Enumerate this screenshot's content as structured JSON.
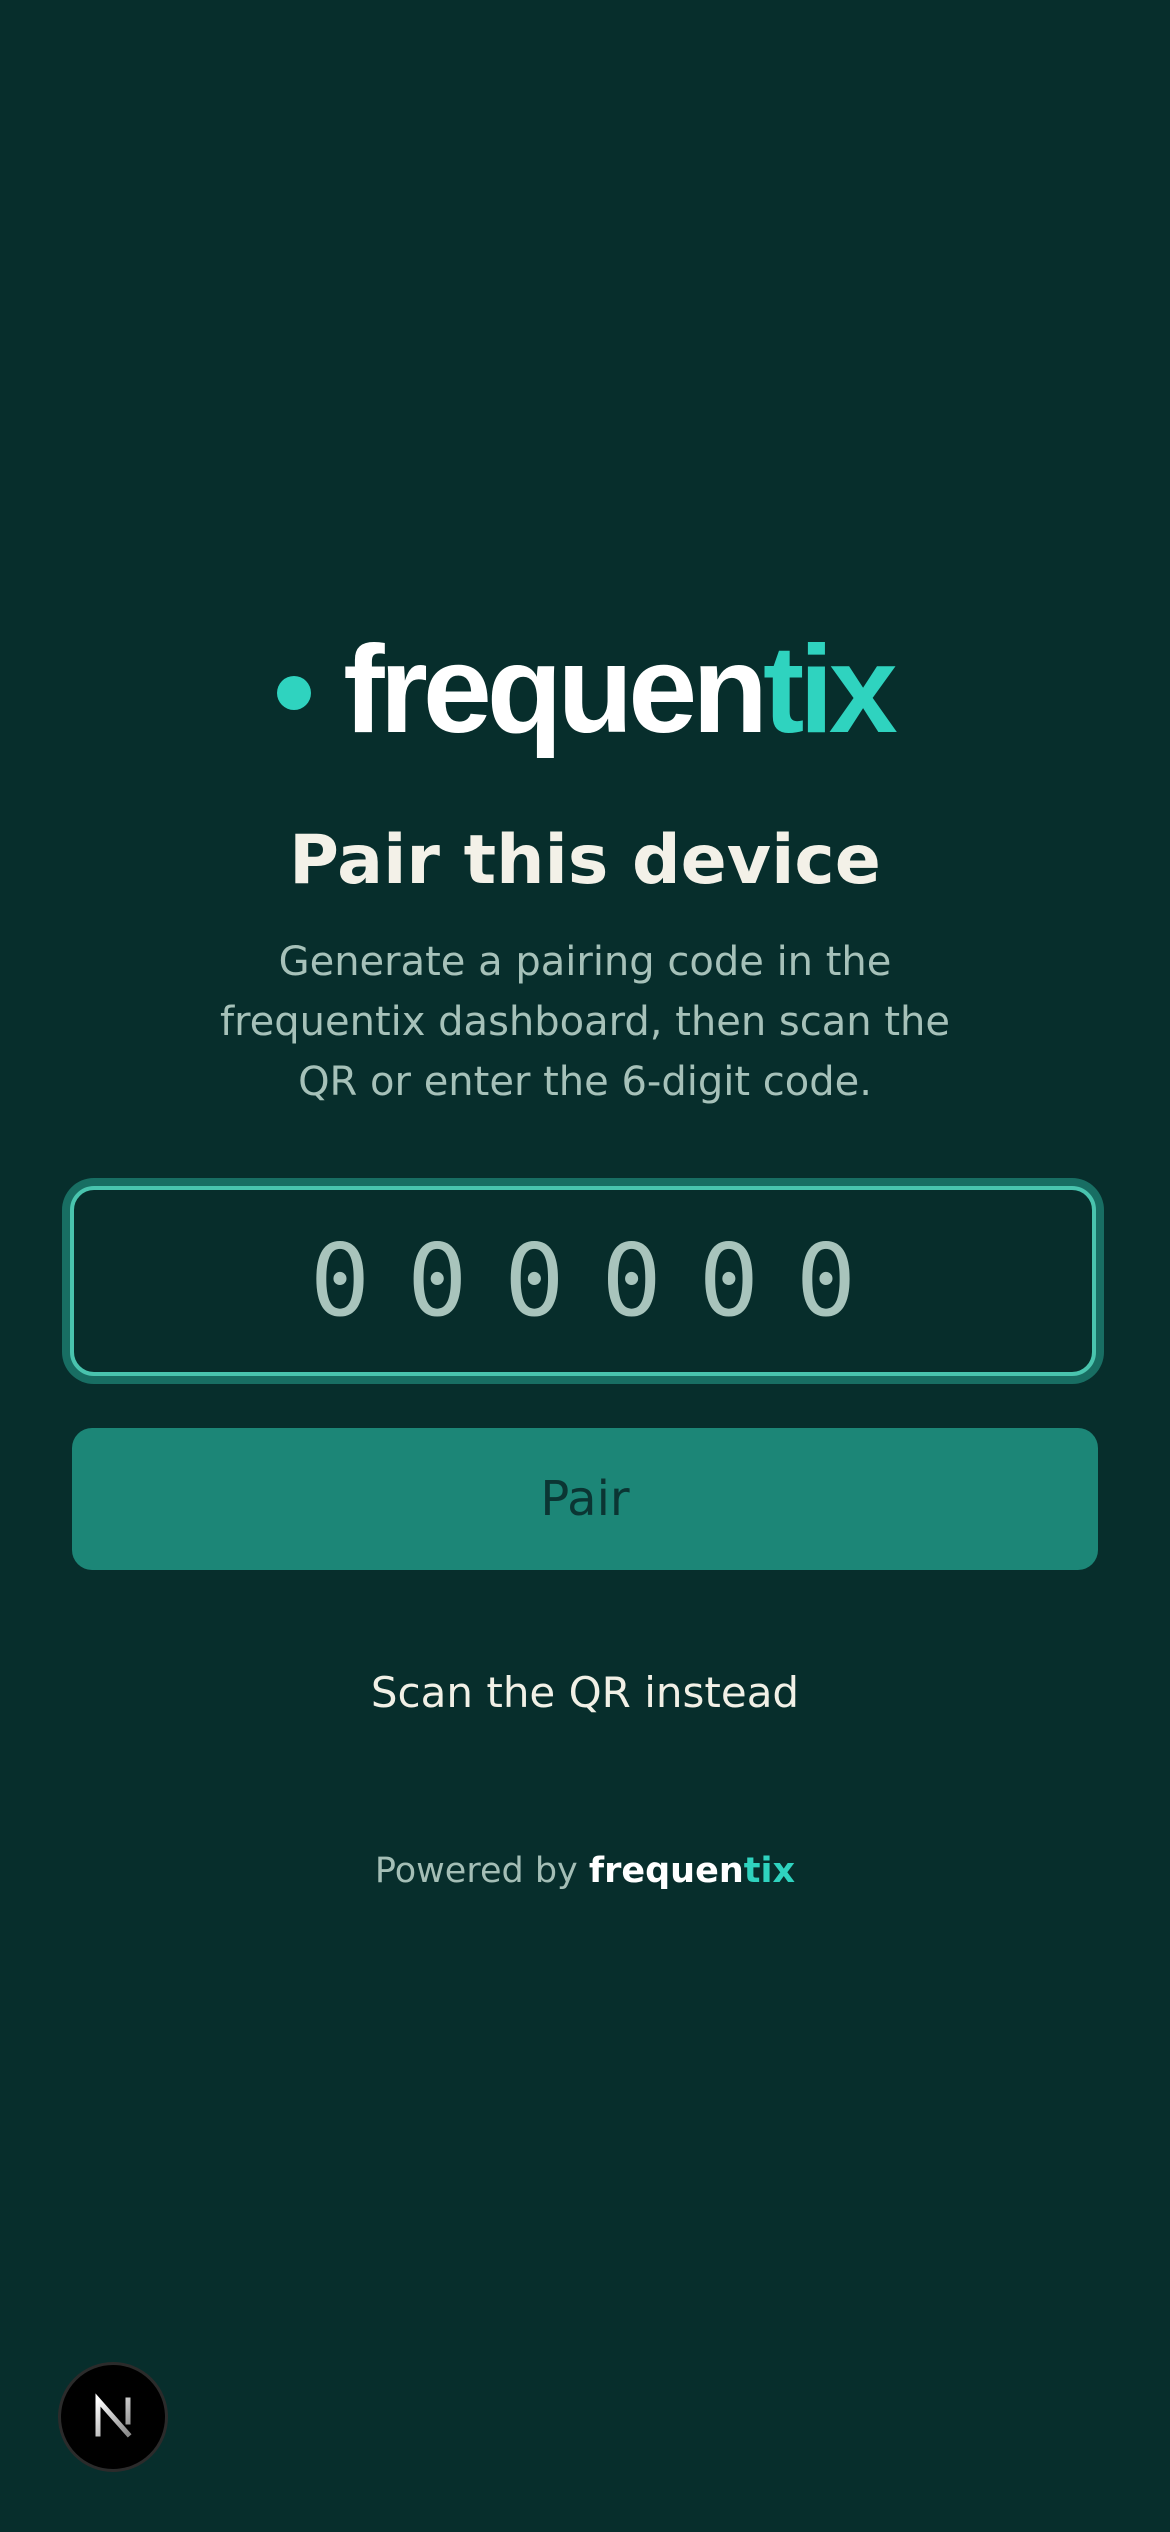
{
  "brand": {
    "wordmark_main": "frequen",
    "wordmark_accent": "tix",
    "dot_color": "#2fd3bf",
    "accent_color": "#2fd3bf"
  },
  "pairing": {
    "title": "Pair this device",
    "instructions": "Generate a pairing code in the frequentix dashboard, then scan the QR or enter the 6-digit code.",
    "code_placeholder": "000000",
    "pair_label": "Pair",
    "scan_label": "Scan the QR instead"
  },
  "footer": {
    "powered_prefix": "Powered by",
    "brand_main": "frequen",
    "brand_accent": "tix"
  },
  "dev_indicator": {
    "icon": "nextjs-n-icon",
    "letter": "N"
  },
  "colors": {
    "background": "#072e2c",
    "button": "#1c8677",
    "input_border": "#49c4ae"
  }
}
